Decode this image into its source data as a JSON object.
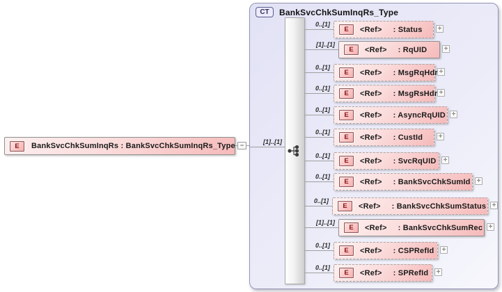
{
  "diagram": {
    "root": {
      "badge": "E",
      "label": "BankSvcChkSumInqRs : BankSvcChkSumInqRs_Type"
    },
    "container": {
      "badge": "CT",
      "title": "BankSvcChkSumInqRs_Type",
      "compositor": "sequence",
      "compositor_cardinality": "[1]..[1]"
    },
    "children": [
      {
        "badge": "E",
        "ref": "<Ref>",
        "name": ": Status",
        "cardinality": "0..[1]",
        "required": false
      },
      {
        "badge": "E",
        "ref": "<Ref>",
        "name": ": RqUID",
        "cardinality": "[1]..[1]",
        "required": true
      },
      {
        "badge": "E",
        "ref": "<Ref>",
        "name": ": MsgRqHdr",
        "cardinality": "0..[1]",
        "required": false
      },
      {
        "badge": "E",
        "ref": "<Ref>",
        "name": ": MsgRsHdr",
        "cardinality": "0..[1]",
        "required": false
      },
      {
        "badge": "E",
        "ref": "<Ref>",
        "name": ": AsyncRqUID",
        "cardinality": "0..[1]",
        "required": false
      },
      {
        "badge": "E",
        "ref": "<Ref>",
        "name": ": CustId",
        "cardinality": "0..[1]",
        "required": false
      },
      {
        "badge": "E",
        "ref": "<Ref>",
        "name": ": SvcRqUID",
        "cardinality": "0..[1]",
        "required": false
      },
      {
        "badge": "E",
        "ref": "<Ref>",
        "name": ": BankSvcChkSumId",
        "cardinality": "0..[1]",
        "required": false
      },
      {
        "badge": "E",
        "ref": "<Ref>",
        "name": ": BankSvcChkSumStatus",
        "cardinality": "0..[1]",
        "required": false
      },
      {
        "badge": "E",
        "ref": "<Ref>",
        "name": ": BankSvcChkSumRec",
        "cardinality": "[1]..[1]",
        "required": true
      },
      {
        "badge": "E",
        "ref": "<Ref>",
        "name": ": CSPRefId",
        "cardinality": "0..[1]",
        "required": false
      },
      {
        "badge": "E",
        "ref": "<Ref>",
        "name": ": SPRefId",
        "cardinality": "0..[1]",
        "required": false
      }
    ],
    "icons": {
      "expand": "+",
      "collapse": "−"
    },
    "colors": {
      "container_fill": "#e2e2f6",
      "container_border": "#9494b4",
      "element_fill_light": "#fdf0f0",
      "element_fill_dark": "#f6baba",
      "element_border": "#8f8f8f",
      "badge_text": "#8b1515",
      "ct_badge_text": "#2e2e5e",
      "connector_line": "#a0a0a0"
    }
  }
}
